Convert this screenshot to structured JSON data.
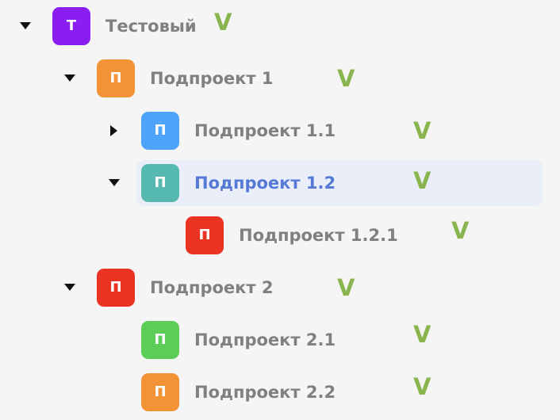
{
  "colors": {
    "badge_purple": "#8a1ef0",
    "badge_orange": "#f29338",
    "badge_blue": "#4ea3fb",
    "badge_teal": "#56b9b0",
    "badge_red": "#ea3323",
    "badge_green": "#5ccd56",
    "label_text": "#808080",
    "selected_text": "#5679d6",
    "selected_bg": "#e9eef8",
    "check": "#8ab54e"
  },
  "tree": {
    "items": [
      {
        "label": "Тестовый",
        "badge_letter": "Т",
        "badge_color": "#8a1ef0",
        "caret": "expanded",
        "check": "V",
        "selected": false
      },
      {
        "label": "Подпроект 1",
        "badge_letter": "П",
        "badge_color": "#f29338",
        "caret": "expanded",
        "check": "V",
        "selected": false
      },
      {
        "label": "Подпроект 1.1",
        "badge_letter": "П",
        "badge_color": "#4ea3fb",
        "caret": "collapsed",
        "check": "V",
        "selected": false
      },
      {
        "label": "Подпроект 1.2",
        "badge_letter": "П",
        "badge_color": "#56b9b0",
        "caret": "expanded",
        "check": "V",
        "selected": true
      },
      {
        "label": "Подпроект 1.2.1",
        "badge_letter": "П",
        "badge_color": "#ea3323",
        "caret": "none",
        "check": "V",
        "selected": false
      },
      {
        "label": "Подпроект 2",
        "badge_letter": "П",
        "badge_color": "#ea3323",
        "caret": "expanded",
        "check": "V",
        "selected": false
      },
      {
        "label": "Подпроект 2.1",
        "badge_letter": "П",
        "badge_color": "#5ccd56",
        "caret": "none",
        "check": "V",
        "selected": false
      },
      {
        "label": "Подпроект 2.2",
        "badge_letter": "П",
        "badge_color": "#f29338",
        "caret": "none",
        "check": "V",
        "selected": false
      }
    ]
  }
}
